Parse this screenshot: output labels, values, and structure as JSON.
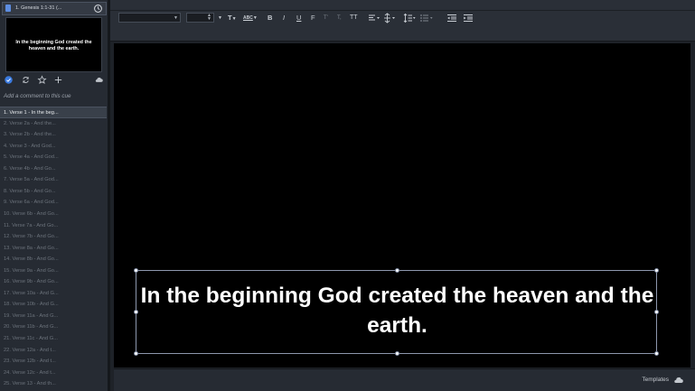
{
  "cue": {
    "title": "1.  Genesis 1:1-31 (...",
    "thumbnail_text": "In the beginning God created the heaven and the earth.",
    "comment_placeholder": "Add a comment to this cue"
  },
  "verses": [
    "1.  Verse 1 - In the beg...",
    "2.  Verse 2a - And the...",
    "3.  Verse 2b - And the...",
    "4.  Verse 3 - And God...",
    "5.  Verse 4a - And God...",
    "6.  Verse 4b - And Go...",
    "7.  Verse 5a - And God...",
    "8.  Verse 5b - And Go...",
    "9.  Verse 6a - And God...",
    "10.  Verse 6b - And Go...",
    "11.  Verse 7a - And Go...",
    "12.  Verse 7b - And Go...",
    "13.  Verse 8a - And Go...",
    "14.  Verse 8b - And Go...",
    "15.  Verse 9a - And Go...",
    "16.  Verse 9b - And Go...",
    "17.  Verse 10a - And G...",
    "18.  Verse 10b - And G...",
    "19.  Verse 11a - And G...",
    "20.  Verse 11b - And G...",
    "21.  Verse 11c - And G...",
    "22.  Verse 12a - And t...",
    "23.  Verse 12b - And t...",
    "24.  Verse 12c - And t...",
    "25.  Verse 13 - And th..."
  ],
  "selected_verse_index": 0,
  "toolbar": {
    "text_color_label": "T",
    "highlight_label": "ABC",
    "bold_label": "B",
    "italic_label": "I",
    "underline_label": "U",
    "strike_label": "F",
    "superscript_label": "T'",
    "subscript_label": "T,",
    "uppercase_label": "TT"
  },
  "slide": {
    "text": "In the beginning God created the heaven and the earth."
  },
  "bottom": {
    "templates_label": "Templates"
  },
  "colors": {
    "selected_badge": "#3b7be0",
    "selection_border": "#8d97ad"
  }
}
